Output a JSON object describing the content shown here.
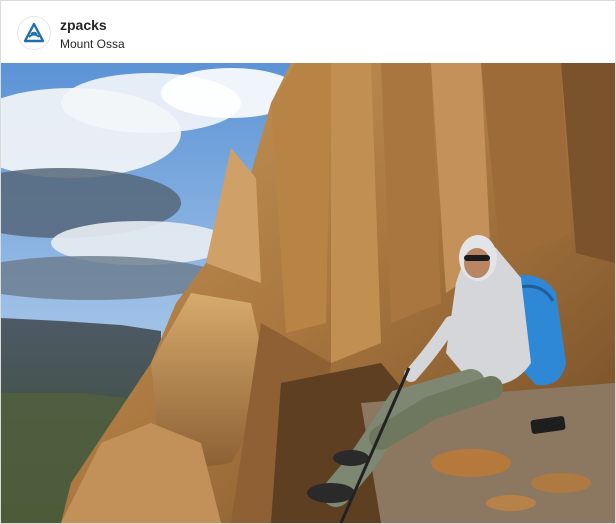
{
  "post": {
    "username": "zpacks",
    "location": "Mount Ossa",
    "avatar_icon": "zpacks-logo-icon",
    "brand_color": "#1f6fa8"
  },
  "photo": {
    "subject_icon": "hiker-on-rock-photo"
  }
}
